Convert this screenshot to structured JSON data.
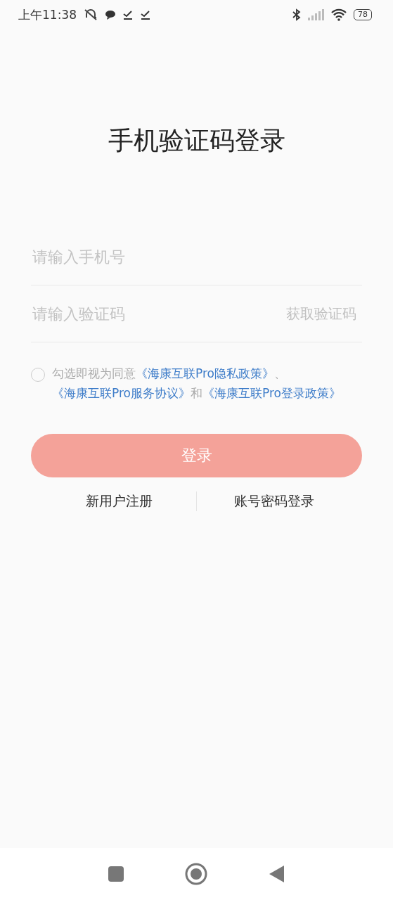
{
  "status_bar": {
    "time": "上午11:38",
    "battery": "78"
  },
  "title": "手机验证码登录",
  "phone_field": {
    "placeholder": "请输入手机号"
  },
  "code_field": {
    "placeholder": "请输入验证码",
    "action": "获取验证码"
  },
  "agreement": {
    "checked": false,
    "parts": [
      {
        "kind": "text",
        "text": "勾选即视为同意"
      },
      {
        "kind": "link",
        "text": "《海康互联Pro隐私政策》"
      },
      {
        "kind": "text",
        "text": "、"
      },
      {
        "kind": "link",
        "text": "《海康互联Pro服务协议》"
      },
      {
        "kind": "text",
        "text": "和"
      },
      {
        "kind": "link",
        "text": "《海康互联Pro登录政策》"
      }
    ]
  },
  "login_button": {
    "label": "登录",
    "disabled": true
  },
  "links": [
    "新用户注册",
    "账号密码登录"
  ]
}
